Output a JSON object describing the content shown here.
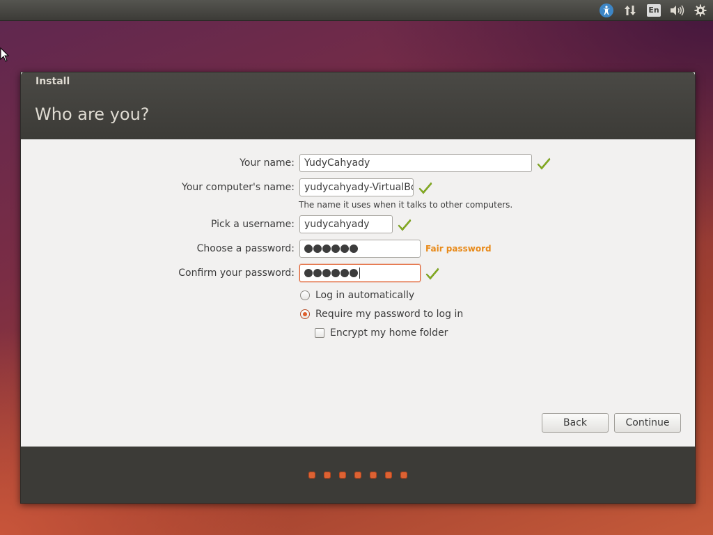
{
  "top_panel": {
    "language_indicator": "En",
    "icons": [
      "accessibility-icon",
      "network-icon",
      "keyboard-language-indicator",
      "sound-icon",
      "gear-icon"
    ]
  },
  "window": {
    "title": "Install",
    "heading": "Who are you?"
  },
  "form": {
    "name": {
      "label": "Your name:",
      "value": "YudyCahyady",
      "valid": true
    },
    "computer_name": {
      "label": "Your computer's name:",
      "value": "yudycahyady-VirtualBo",
      "valid": true,
      "hint": "The name it uses when it talks to other computers."
    },
    "username": {
      "label": "Pick a username:",
      "value": "yudycahyady",
      "valid": true
    },
    "password": {
      "label": "Choose a password:",
      "masked_length": 6,
      "strength": "Fair password"
    },
    "confirm_password": {
      "label": "Confirm your password:",
      "masked_length": 6,
      "valid": true
    },
    "login_options": {
      "auto_login": {
        "label": "Log in automatically",
        "selected": false
      },
      "require_password": {
        "label": "Require my password to log in",
        "selected": true
      },
      "encrypt_home": {
        "label": "Encrypt my home folder",
        "checked": false
      }
    }
  },
  "buttons": {
    "back": "Back",
    "continue": "Continue"
  },
  "progress": {
    "total_steps": 7
  },
  "colors": {
    "accent": "#e05d2a",
    "check_green": "#8ab521",
    "strength_orange": "#e88a1a",
    "dark_header": "#3c3b37"
  }
}
